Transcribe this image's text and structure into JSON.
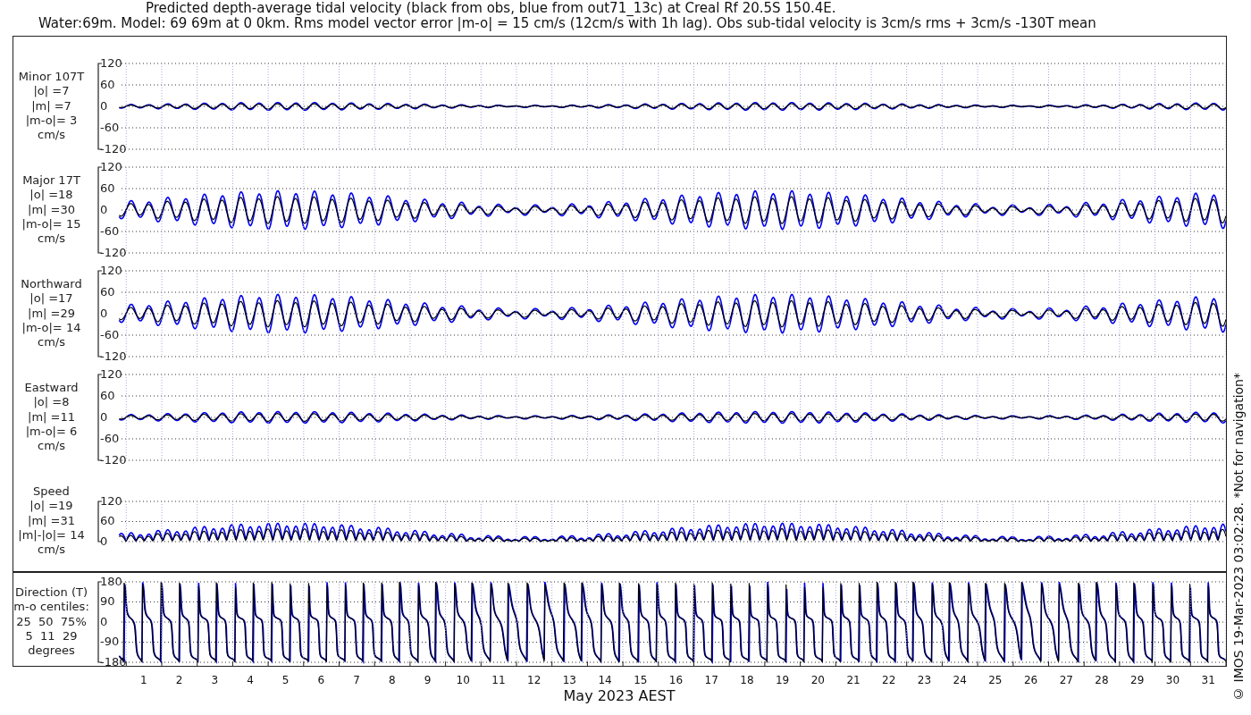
{
  "title": {
    "lines": [
      "Predicted depth-average tidal velocity (black from obs, blue from out71_13c) at Creal Rf 20.5S 150.4E.",
      "Water:69m. Model: 69 69m at 0 0km. Rms model vector error |m-o| = 15 cm/s (12cm/s with 1h lag). Obs sub-tidal velocity is 3cm/s rms + 3cm/s -130T mean"
    ]
  },
  "panels": [
    {
      "kind": "velocity",
      "label_lines": [
        "Minor 107T",
        "|o| =7",
        "|m| =7",
        "|m-o|= 3",
        "cm/s"
      ],
      "yticks": [
        "120",
        "60",
        "0",
        "-60",
        "-120"
      ]
    },
    {
      "kind": "velocity",
      "label_lines": [
        "Major 17T",
        "|o| =18",
        "|m| =30",
        "|m-o|= 15",
        "cm/s"
      ],
      "yticks": [
        "120",
        "60",
        "0",
        "-60",
        "-120"
      ]
    },
    {
      "kind": "velocity",
      "label_lines": [
        "Northward",
        "|o| =17",
        "|m| =29",
        "|m-o|= 14",
        "cm/s"
      ],
      "yticks": [
        "120",
        "60",
        "0",
        "-60",
        "-120"
      ]
    },
    {
      "kind": "velocity",
      "label_lines": [
        "Eastward",
        "|o| =8",
        "|m| =11",
        "|m-o|= 6",
        "cm/s"
      ],
      "yticks": [
        "120",
        "60",
        "0",
        "-60",
        "-120"
      ]
    },
    {
      "kind": "speed",
      "label_lines": [
        "Speed",
        "|o| =19",
        "|m| =31",
        "|m|-|o|= 14",
        "cm/s"
      ],
      "yticks": [
        "120",
        "60",
        "0"
      ]
    },
    {
      "kind": "direction",
      "label_lines": [
        "Direction (T)",
        "m-o centiles:",
        "25  50  75%",
        "5  11  29",
        "degrees"
      ],
      "yticks": [
        "180",
        "90",
        "0",
        "-90",
        "-180"
      ]
    }
  ],
  "x_axis": {
    "ticks": [
      "1",
      "2",
      "3",
      "4",
      "5",
      "6",
      "7",
      "8",
      "9",
      "10",
      "11",
      "12",
      "13",
      "14",
      "15",
      "16",
      "17",
      "18",
      "19",
      "20",
      "21",
      "22",
      "23",
      "24",
      "25",
      "26",
      "27",
      "28",
      "29",
      "30",
      "31"
    ],
    "label": "May 2023 AEST"
  },
  "copyright": "© IMOS 19-Mar-2023 03:02:28. *Not for navigation*"
}
